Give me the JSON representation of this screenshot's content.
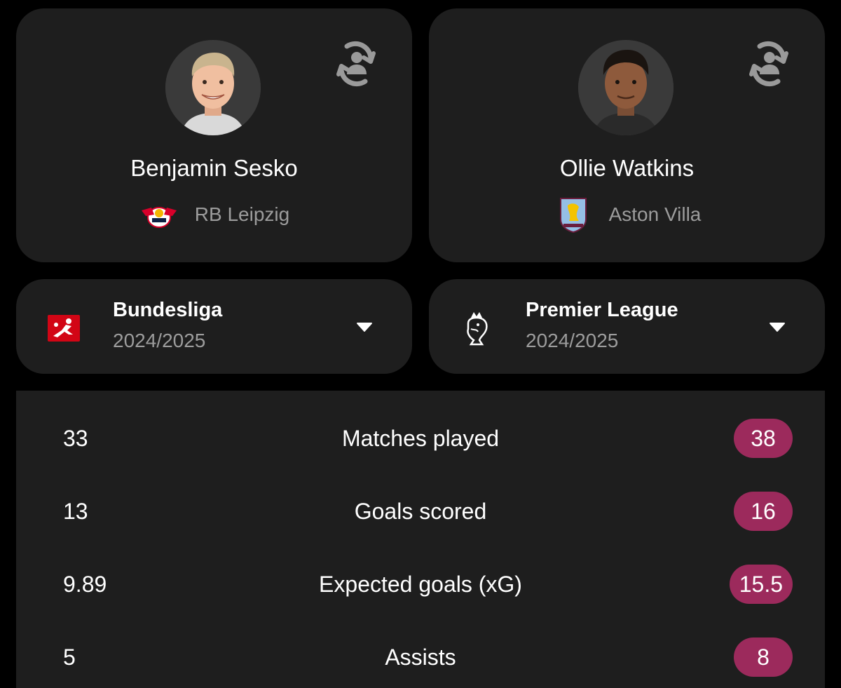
{
  "players": [
    {
      "name": "Benjamin Sesko",
      "team": "RB Leipzig",
      "avatar_icon": "player-photo",
      "team_logo_icon": "rb-leipzig-crest",
      "swap_icon": "swap-player-icon"
    },
    {
      "name": "Ollie Watkins",
      "team": "Aston Villa",
      "avatar_icon": "player-photo",
      "team_logo_icon": "aston-villa-crest",
      "swap_icon": "swap-player-icon"
    }
  ],
  "leagues": [
    {
      "name": "Bundesliga",
      "season": "2024/2025",
      "logo_icon": "bundesliga-logo",
      "dropdown_icon": "chevron-down-icon"
    },
    {
      "name": "Premier League",
      "season": "2024/2025",
      "logo_icon": "premier-league-logo",
      "dropdown_icon": "chevron-down-icon"
    }
  ],
  "stats": [
    {
      "label": "Matches played",
      "left": "33",
      "right": "38"
    },
    {
      "label": "Goals scored",
      "left": "13",
      "right": "16"
    },
    {
      "label": "Expected goals (xG)",
      "left": "9.89",
      "right": "15.5"
    },
    {
      "label": "Assists",
      "left": "5",
      "right": "8"
    }
  ],
  "colors": {
    "background": "#000000",
    "card": "#1e1e1e",
    "highlight": "#9c2a5c",
    "secondary_text": "#9c9c9c"
  }
}
